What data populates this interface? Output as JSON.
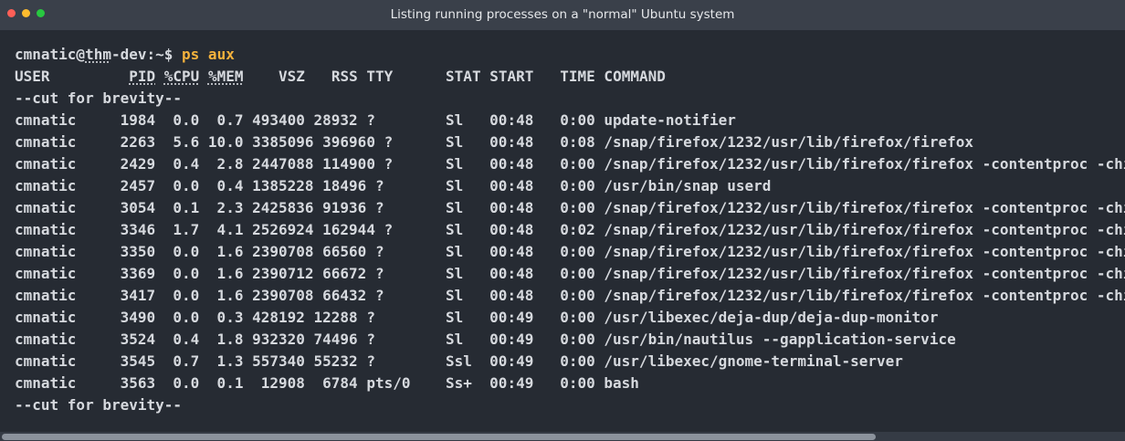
{
  "window": {
    "title": "Listing running processes on a \"normal\" Ubuntu system",
    "colors": {
      "close": "#ff5f57",
      "minimize": "#febc2e",
      "maximize": "#28c840",
      "prompt_command": "#f4b23c"
    }
  },
  "terminal": {
    "prompt_user": "cmnatic@",
    "prompt_host": "thm",
    "prompt_rest": "-dev:~$ ",
    "command": "ps aux",
    "header": {
      "user": "USER         ",
      "pid": "PID",
      "cpu_sep": " ",
      "cpu": "%CPU",
      "mem_sep": " ",
      "mem": "%MEM",
      "rest": "    VSZ   RSS TTY      STAT START   TIME COMMAND"
    },
    "cut_top": "--cut for brevity--",
    "rows": [
      "cmnatic     1984  0.0  0.7 493400 28932 ?        Sl   00:48   0:00 update-notifier",
      "cmnatic     2263  5.6 10.0 3385096 396960 ?      Sl   00:48   0:08 /snap/firefox/1232/usr/lib/firefox/firefox",
      "cmnatic     2429  0.4  2.8 2447088 114900 ?      Sl   00:48   0:00 /snap/firefox/1232/usr/lib/firefox/firefox -contentproc -chi",
      "cmnatic     2457  0.0  0.4 1385228 18496 ?       Sl   00:48   0:00 /usr/bin/snap userd",
      "cmnatic     3054  0.1  2.3 2425836 91936 ?       Sl   00:48   0:00 /snap/firefox/1232/usr/lib/firefox/firefox -contentproc -chi",
      "cmnatic     3346  1.7  4.1 2526924 162944 ?      Sl   00:48   0:02 /snap/firefox/1232/usr/lib/firefox/firefox -contentproc -chi",
      "cmnatic     3350  0.0  1.6 2390708 66560 ?       Sl   00:48   0:00 /snap/firefox/1232/usr/lib/firefox/firefox -contentproc -chi",
      "cmnatic     3369  0.0  1.6 2390712 66672 ?       Sl   00:48   0:00 /snap/firefox/1232/usr/lib/firefox/firefox -contentproc -chi",
      "cmnatic     3417  0.0  1.6 2390708 66432 ?       Sl   00:48   0:00 /snap/firefox/1232/usr/lib/firefox/firefox -contentproc -chi",
      "cmnatic     3490  0.0  0.3 428192 12288 ?        Sl   00:49   0:00 /usr/libexec/deja-dup/deja-dup-monitor",
      "cmnatic     3524  0.4  1.8 932320 74496 ?        Sl   00:49   0:00 /usr/bin/nautilus --gapplication-service",
      "cmnatic     3545  0.7  1.3 557340 55232 ?        Ssl  00:49   0:00 /usr/libexec/gnome-terminal-server",
      "cmnatic     3563  0.0  0.1  12908  6784 pts/0    Ss+  00:49   0:00 bash"
    ],
    "cut_bottom": "--cut for brevity--"
  }
}
